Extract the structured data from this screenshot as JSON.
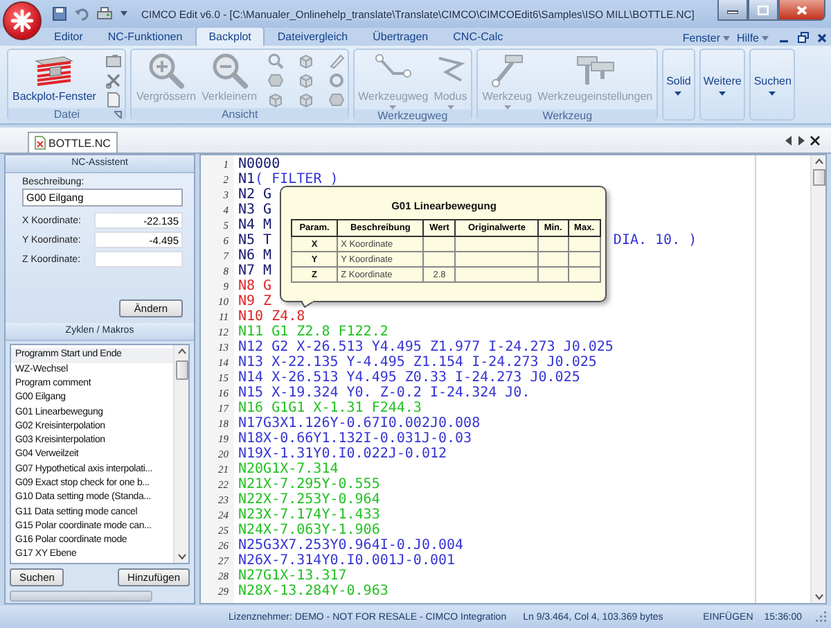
{
  "window": {
    "title": "CIMCO Edit v6.0 - [C:\\Manualer_Onlinehelp_translate\\Translate\\CIMCO\\CIMCOEdit6\\Samples\\ISO MILL\\BOTTLE.NC]"
  },
  "menu_tabs": [
    {
      "label": "Editor",
      "selected": false
    },
    {
      "label": "NC-Funktionen",
      "selected": false
    },
    {
      "label": "Backplot",
      "selected": true
    },
    {
      "label": "Dateivergleich",
      "selected": false
    },
    {
      "label": "Übertragen",
      "selected": false
    },
    {
      "label": "CNC-Calc",
      "selected": false
    }
  ],
  "menu_right": [
    {
      "label": "Fenster"
    },
    {
      "label": "Hilfe"
    }
  ],
  "ribbon": {
    "groups": [
      {
        "label": "Datei",
        "buttons": [
          {
            "label": "Backplot-Fenster",
            "disabled": false,
            "dropdown": false
          }
        ]
      },
      {
        "label": "Ansicht",
        "buttons": [
          {
            "label": "Vergrössern",
            "disabled": true,
            "dropdown": false
          },
          {
            "label": "Verkleinern",
            "disabled": true,
            "dropdown": false
          }
        ]
      },
      {
        "label": "Werkzeugweg",
        "buttons": [
          {
            "label": "Werkzeugweg",
            "disabled": true,
            "dropdown": true
          },
          {
            "label": "Modus",
            "disabled": true,
            "dropdown": true
          }
        ]
      },
      {
        "label": "Werkzeug",
        "buttons": [
          {
            "label": "Werkzeug",
            "disabled": true,
            "dropdown": true
          },
          {
            "label": "Werkzeugeinstellungen",
            "disabled": true,
            "dropdown": false
          }
        ]
      }
    ],
    "menu_buttons": [
      {
        "label": "Solid",
        "dropdown": true
      },
      {
        "label": "Weitere",
        "dropdown": true
      },
      {
        "label": "Suchen",
        "dropdown": true
      }
    ]
  },
  "document_tab": {
    "label": "BOTTLE.NC",
    "selected": true
  },
  "nc_assistant": {
    "title": "NC-Assistent",
    "description_label": "Beschreibung:",
    "description": "G00 Eilgang",
    "fields": [
      {
        "label": "X Koordinate:",
        "value": "-22.135"
      },
      {
        "label": "Y Koordinate:",
        "value": "-4.495"
      },
      {
        "label": "Z Koordinate:"
      }
    ],
    "button": "Ändern"
  },
  "macros": {
    "title": "Zyklen / Makros",
    "items": [
      {
        "label": "Programm Start und Ende",
        "selected": true
      },
      {
        "label": "WZ-Wechsel",
        "selected": false
      },
      {
        "label": "Program comment",
        "selected": false
      },
      {
        "label": "G00 Eilgang",
        "selected": false
      },
      {
        "label": "G01 Linearbewegung",
        "selected": false
      },
      {
        "label": "G02 Kreisinterpolation",
        "selected": false
      },
      {
        "label": "G03 Kreisinterpolation",
        "selected": false
      },
      {
        "label": "G04 Verweilzeit",
        "selected": false
      },
      {
        "label": "G07 Hypothetical axis interpolati...",
        "selected": false
      },
      {
        "label": "G09 Exact stop check for one b...",
        "selected": false
      },
      {
        "label": "G10 Data setting mode (Standa...",
        "selected": false
      },
      {
        "label": "G11 Data setting mode cancel",
        "selected": false
      },
      {
        "label": "G15 Polar coordinate mode can...",
        "selected": false
      },
      {
        "label": "G16 Polar coordinate mode",
        "selected": false
      },
      {
        "label": "G17 XY Ebene",
        "selected": false
      }
    ],
    "buttons": [
      "Suchen",
      "Hinzufügen"
    ]
  },
  "editor": {
    "lines": [
      {
        "number": "1",
        "segments": [
          {
            "text": "N0000",
            "color": "#14146e",
            "kind": "inline"
          }
        ]
      },
      {
        "number": "2",
        "segments": [
          {
            "text": "N1 ",
            "color": "#14146e",
            "kind": "inline"
          },
          {
            "text": "( FILTER )",
            "color": "#3434d4",
            "kind": "inline"
          }
        ]
      },
      {
        "number": "3",
        "segments": [
          {
            "text": "N2 G",
            "color": "#14146e",
            "kind": "inline"
          }
        ]
      },
      {
        "number": "4",
        "segments": [
          {
            "text": "N3 G",
            "color": "#14146e",
            "kind": "inline"
          }
        ]
      },
      {
        "number": "5",
        "segments": [
          {
            "text": "N4 M",
            "color": "#14146e",
            "kind": "inline"
          }
        ]
      },
      {
        "number": "6",
        "segments": [
          {
            "text": "N5 T",
            "color": "#14146e",
            "kind": "inline"
          },
          {
            "text": "DIA. 10. )",
            "color": "#3434d4",
            "kind": "after-overlay"
          }
        ]
      },
      {
        "number": "7",
        "segments": [
          {
            "text": "N6 M",
            "color": "#14146e",
            "kind": "inline"
          }
        ]
      },
      {
        "number": "8",
        "segments": [
          {
            "text": "N7 M",
            "color": "#14146e",
            "kind": "inline"
          }
        ]
      },
      {
        "number": "9",
        "segments": [
          {
            "text": "N8 G",
            "color": "#e02424",
            "kind": "inline"
          }
        ]
      },
      {
        "number": "10",
        "segments": [
          {
            "text": "N9 Z",
            "color": "#e02424",
            "kind": "inline"
          }
        ]
      },
      {
        "number": "11",
        "segments": [
          {
            "text": "N10 Z4.8",
            "color": "#e02424",
            "kind": "inline"
          }
        ]
      },
      {
        "number": "12",
        "segments": [
          {
            "text": "N11 G1 Z2.8 F122.2",
            "color": "#22c022",
            "kind": "inline"
          }
        ]
      },
      {
        "number": "13",
        "segments": [
          {
            "text": "N12 G2 X-26.513 Y4.495 Z1.977 I-24.273 J0.025",
            "color": "#3434d4",
            "kind": "inline"
          }
        ]
      },
      {
        "number": "14",
        "segments": [
          {
            "text": "N13 X-22.135 Y-4.495 Z1.154 I-24.273 J0.025",
            "color": "#3434d4",
            "kind": "inline"
          }
        ]
      },
      {
        "number": "15",
        "segments": [
          {
            "text": "N14 X-26.513 Y4.495 Z0.33 I-24.273 J0.025",
            "color": "#3434d4",
            "kind": "inline"
          }
        ]
      },
      {
        "number": "16",
        "segments": [
          {
            "text": "N15 X-19.324 Y0. Z-0.2 I-24.324 J0.",
            "color": "#3434d4",
            "kind": "inline"
          }
        ]
      },
      {
        "number": "17",
        "segments": [
          {
            "text": "N16 G1G1 X-1.31 F244.3",
            "color": "#22c022",
            "kind": "inline"
          }
        ]
      },
      {
        "number": "18",
        "segments": [
          {
            "text": "N17G3X1.126Y-0.67I0.002J0.008",
            "color": "#3434d4",
            "kind": "inline"
          }
        ]
      },
      {
        "number": "19",
        "segments": [
          {
            "text": "N18X-0.66Y1.132I-0.031J-0.03",
            "color": "#3434d4",
            "kind": "inline"
          }
        ]
      },
      {
        "number": "20",
        "segments": [
          {
            "text": "N19X-1.31Y0.I0.022J-0.012",
            "color": "#3434d4",
            "kind": "inline"
          }
        ]
      },
      {
        "number": "21",
        "segments": [
          {
            "text": "N20G1X-7.314",
            "color": "#22c022",
            "kind": "inline"
          }
        ]
      },
      {
        "number": "22",
        "segments": [
          {
            "text": "N21X-7.295Y-0.555",
            "color": "#22c022",
            "kind": "inline"
          }
        ]
      },
      {
        "number": "23",
        "segments": [
          {
            "text": "N22X-7.253Y-0.964",
            "color": "#22c022",
            "kind": "inline"
          }
        ]
      },
      {
        "number": "24",
        "segments": [
          {
            "text": "N23X-7.174Y-1.433",
            "color": "#22c022",
            "kind": "inline"
          }
        ]
      },
      {
        "number": "25",
        "segments": [
          {
            "text": "N24X-7.063Y-1.906",
            "color": "#22c022",
            "kind": "inline"
          }
        ]
      },
      {
        "number": "26",
        "segments": [
          {
            "text": "N25G3X7.253Y0.964I-0.J0.004",
            "color": "#3434d4",
            "kind": "inline"
          }
        ]
      },
      {
        "number": "27",
        "segments": [
          {
            "text": "N26X-7.314Y0.I0.001J-0.001",
            "color": "#3434d4",
            "kind": "inline"
          }
        ]
      },
      {
        "number": "28",
        "segments": [
          {
            "text": "N27G1X-13.317",
            "color": "#22c022",
            "kind": "inline"
          }
        ]
      },
      {
        "number": "29",
        "segments": [
          {
            "text": "N28X-13.284Y-0.963",
            "color": "#22c022",
            "kind": "inline"
          }
        ]
      }
    ]
  },
  "tooltip": {
    "title": "G01 Linearbewegung",
    "columns": [
      "Param.",
      "Beschreibung",
      "Wert",
      "Originalwerte",
      "Min.",
      "Max."
    ],
    "rows": [
      {
        "param": "X",
        "description": "X Koordinate"
      },
      {
        "param": "Y",
        "description": "Y Koordinate"
      },
      {
        "param": "Z",
        "description": "Z Koordinate",
        "value": "2.8"
      }
    ]
  },
  "status_bar": {
    "license": "Lizenznehmer: DEMO - NOT FOR RESALE - CIMCO Integration",
    "position": "Ln 9/3.464, Col 4, 103.369 bytes",
    "mode": "EINFÜGEN",
    "time": "15:36:00"
  }
}
